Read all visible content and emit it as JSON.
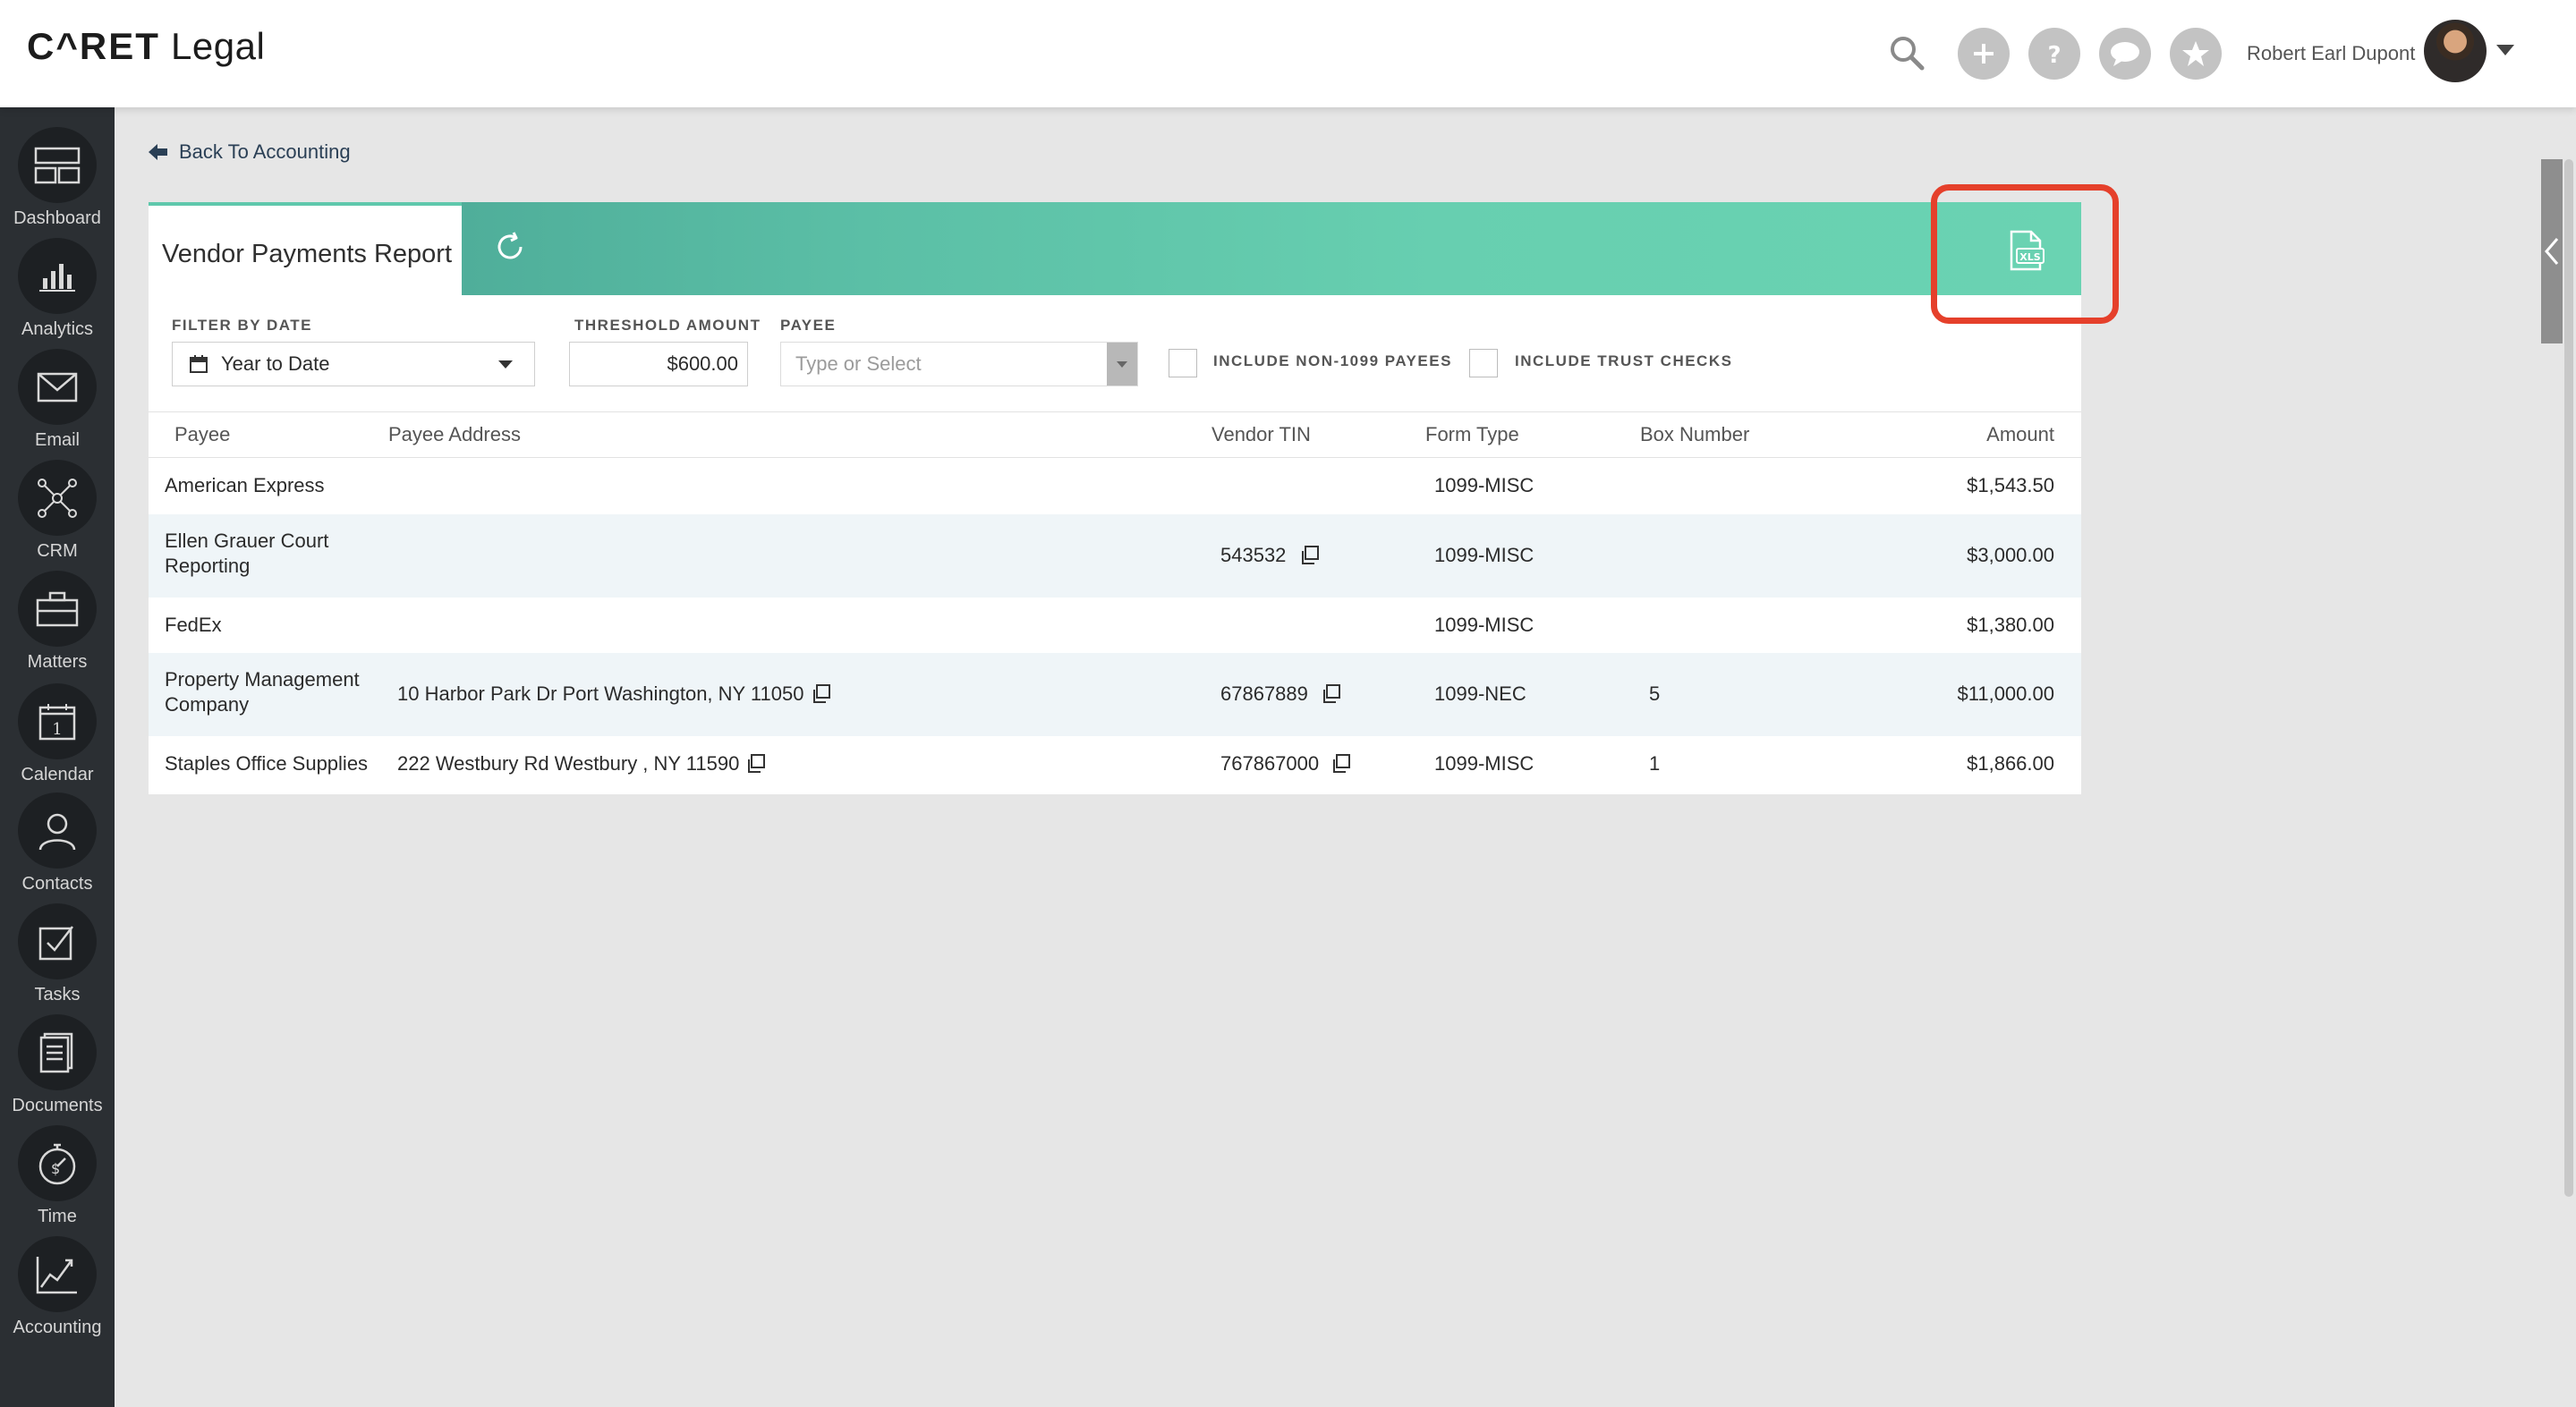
{
  "header": {
    "logo_caret": "C^RET",
    "logo_legal": "Legal",
    "user_name": "Robert Earl Dupont",
    "icons": [
      "search-icon",
      "plus-icon",
      "help-icon",
      "chat-icon",
      "star-icon"
    ]
  },
  "sidebar": {
    "items": [
      {
        "label": "Dashboard",
        "icon": "dashboard-icon"
      },
      {
        "label": "Analytics",
        "icon": "bar-chart-icon"
      },
      {
        "label": "Email",
        "icon": "envelope-icon"
      },
      {
        "label": "CRM",
        "icon": "network-icon"
      },
      {
        "label": "Matters",
        "icon": "briefcase-icon"
      },
      {
        "label": "Calendar",
        "icon": "calendar-icon"
      },
      {
        "label": "Contacts",
        "icon": "person-icon"
      },
      {
        "label": "Tasks",
        "icon": "checkbox-icon"
      },
      {
        "label": "Documents",
        "icon": "document-icon"
      },
      {
        "label": "Time",
        "icon": "stopwatch-icon"
      },
      {
        "label": "Accounting",
        "icon": "line-chart-icon"
      }
    ],
    "calendar_day": "1"
  },
  "nav": {
    "back_label": "Back To Accounting"
  },
  "report": {
    "title": "Vendor Payments Report",
    "export_label": "XLS",
    "filters": {
      "date_label": "FILTER BY DATE",
      "date_value": "Year to Date",
      "threshold_label": "THRESHOLD AMOUNT",
      "threshold_value": "$600.00",
      "payee_label": "PAYEE",
      "payee_placeholder": "Type or Select",
      "non1099_label": "INCLUDE NON-1099 PAYEES",
      "trust_label": "INCLUDE TRUST CHECKS"
    },
    "columns": [
      "Payee",
      "Payee Address",
      "Vendor TIN",
      "Form Type",
      "Box Number",
      "Amount"
    ],
    "rows": [
      {
        "payee": [
          "American Express"
        ],
        "address": "",
        "tin": "",
        "form": "1099-MISC",
        "box": "",
        "amount": "$1,543.50"
      },
      {
        "payee": [
          "Ellen Grauer Court",
          "Reporting"
        ],
        "address": "",
        "tin": "543532",
        "form": "1099-MISC",
        "box": "",
        "amount": "$3,000.00"
      },
      {
        "payee": [
          "FedEx"
        ],
        "address": "",
        "tin": "",
        "form": "1099-MISC",
        "box": "",
        "amount": "$1,380.00"
      },
      {
        "payee": [
          "Property Management",
          "Company"
        ],
        "address": "10 Harbor Park Dr Port Washington, NY 11050",
        "tin": "67867889",
        "form": "1099-NEC",
        "box": "5",
        "amount": "$11,000.00"
      },
      {
        "payee": [
          "Staples Office Supplies"
        ],
        "address": "222 Westbury Rd Westbury , NY 11590",
        "tin": "767867000",
        "form": "1099-MISC",
        "box": "1",
        "amount": "$1,866.00"
      }
    ]
  },
  "colors": {
    "sidebar_bg": "#2b2f33",
    "banner_start": "#4fae9a",
    "banner_end": "#6ad3b2",
    "highlight": "#e5402b",
    "row_alt": "#eff5f8"
  }
}
